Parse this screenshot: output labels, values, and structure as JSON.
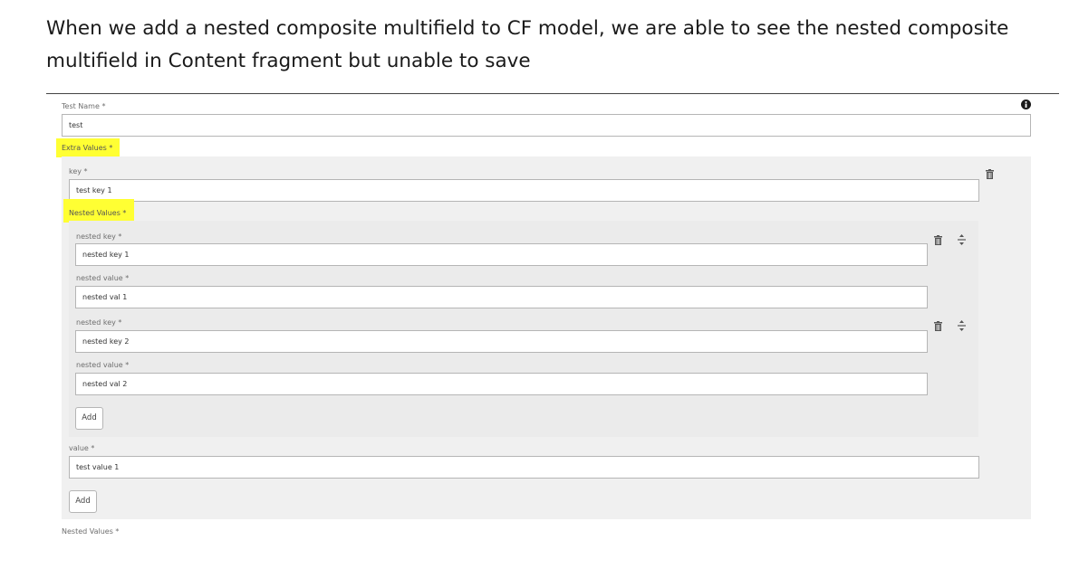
{
  "caption": "When we add a nested composite multifield to CF model, we are able to see the nested composite multifield in Content fragment but unable to save",
  "form": {
    "test_name": {
      "label": "Test Name *",
      "value": "test"
    },
    "extra_values": {
      "label": "Extra Values *",
      "key": {
        "label": "key *",
        "value": "test key 1"
      },
      "nested_values": {
        "label": "Nested Values *",
        "items": [
          {
            "key_label": "nested key *",
            "key_value": "nested key 1",
            "value_label": "nested value *",
            "value_value": "nested val  1"
          },
          {
            "key_label": "nested key *",
            "key_value": "nested key 2",
            "value_label": "nested value *",
            "value_value": "nested val  2"
          }
        ],
        "add_label": "Add"
      },
      "value": {
        "label": "value *",
        "value": "test value 1"
      },
      "add_label": "Add"
    },
    "trailing_label": "Nested Values *"
  },
  "icons": {
    "info": "info-icon",
    "delete": "trash-icon",
    "reorder": "move-icon"
  },
  "colors": {
    "highlight": "#ffff33",
    "panel": "#f0f0f0",
    "border": "#b5b5b5"
  }
}
